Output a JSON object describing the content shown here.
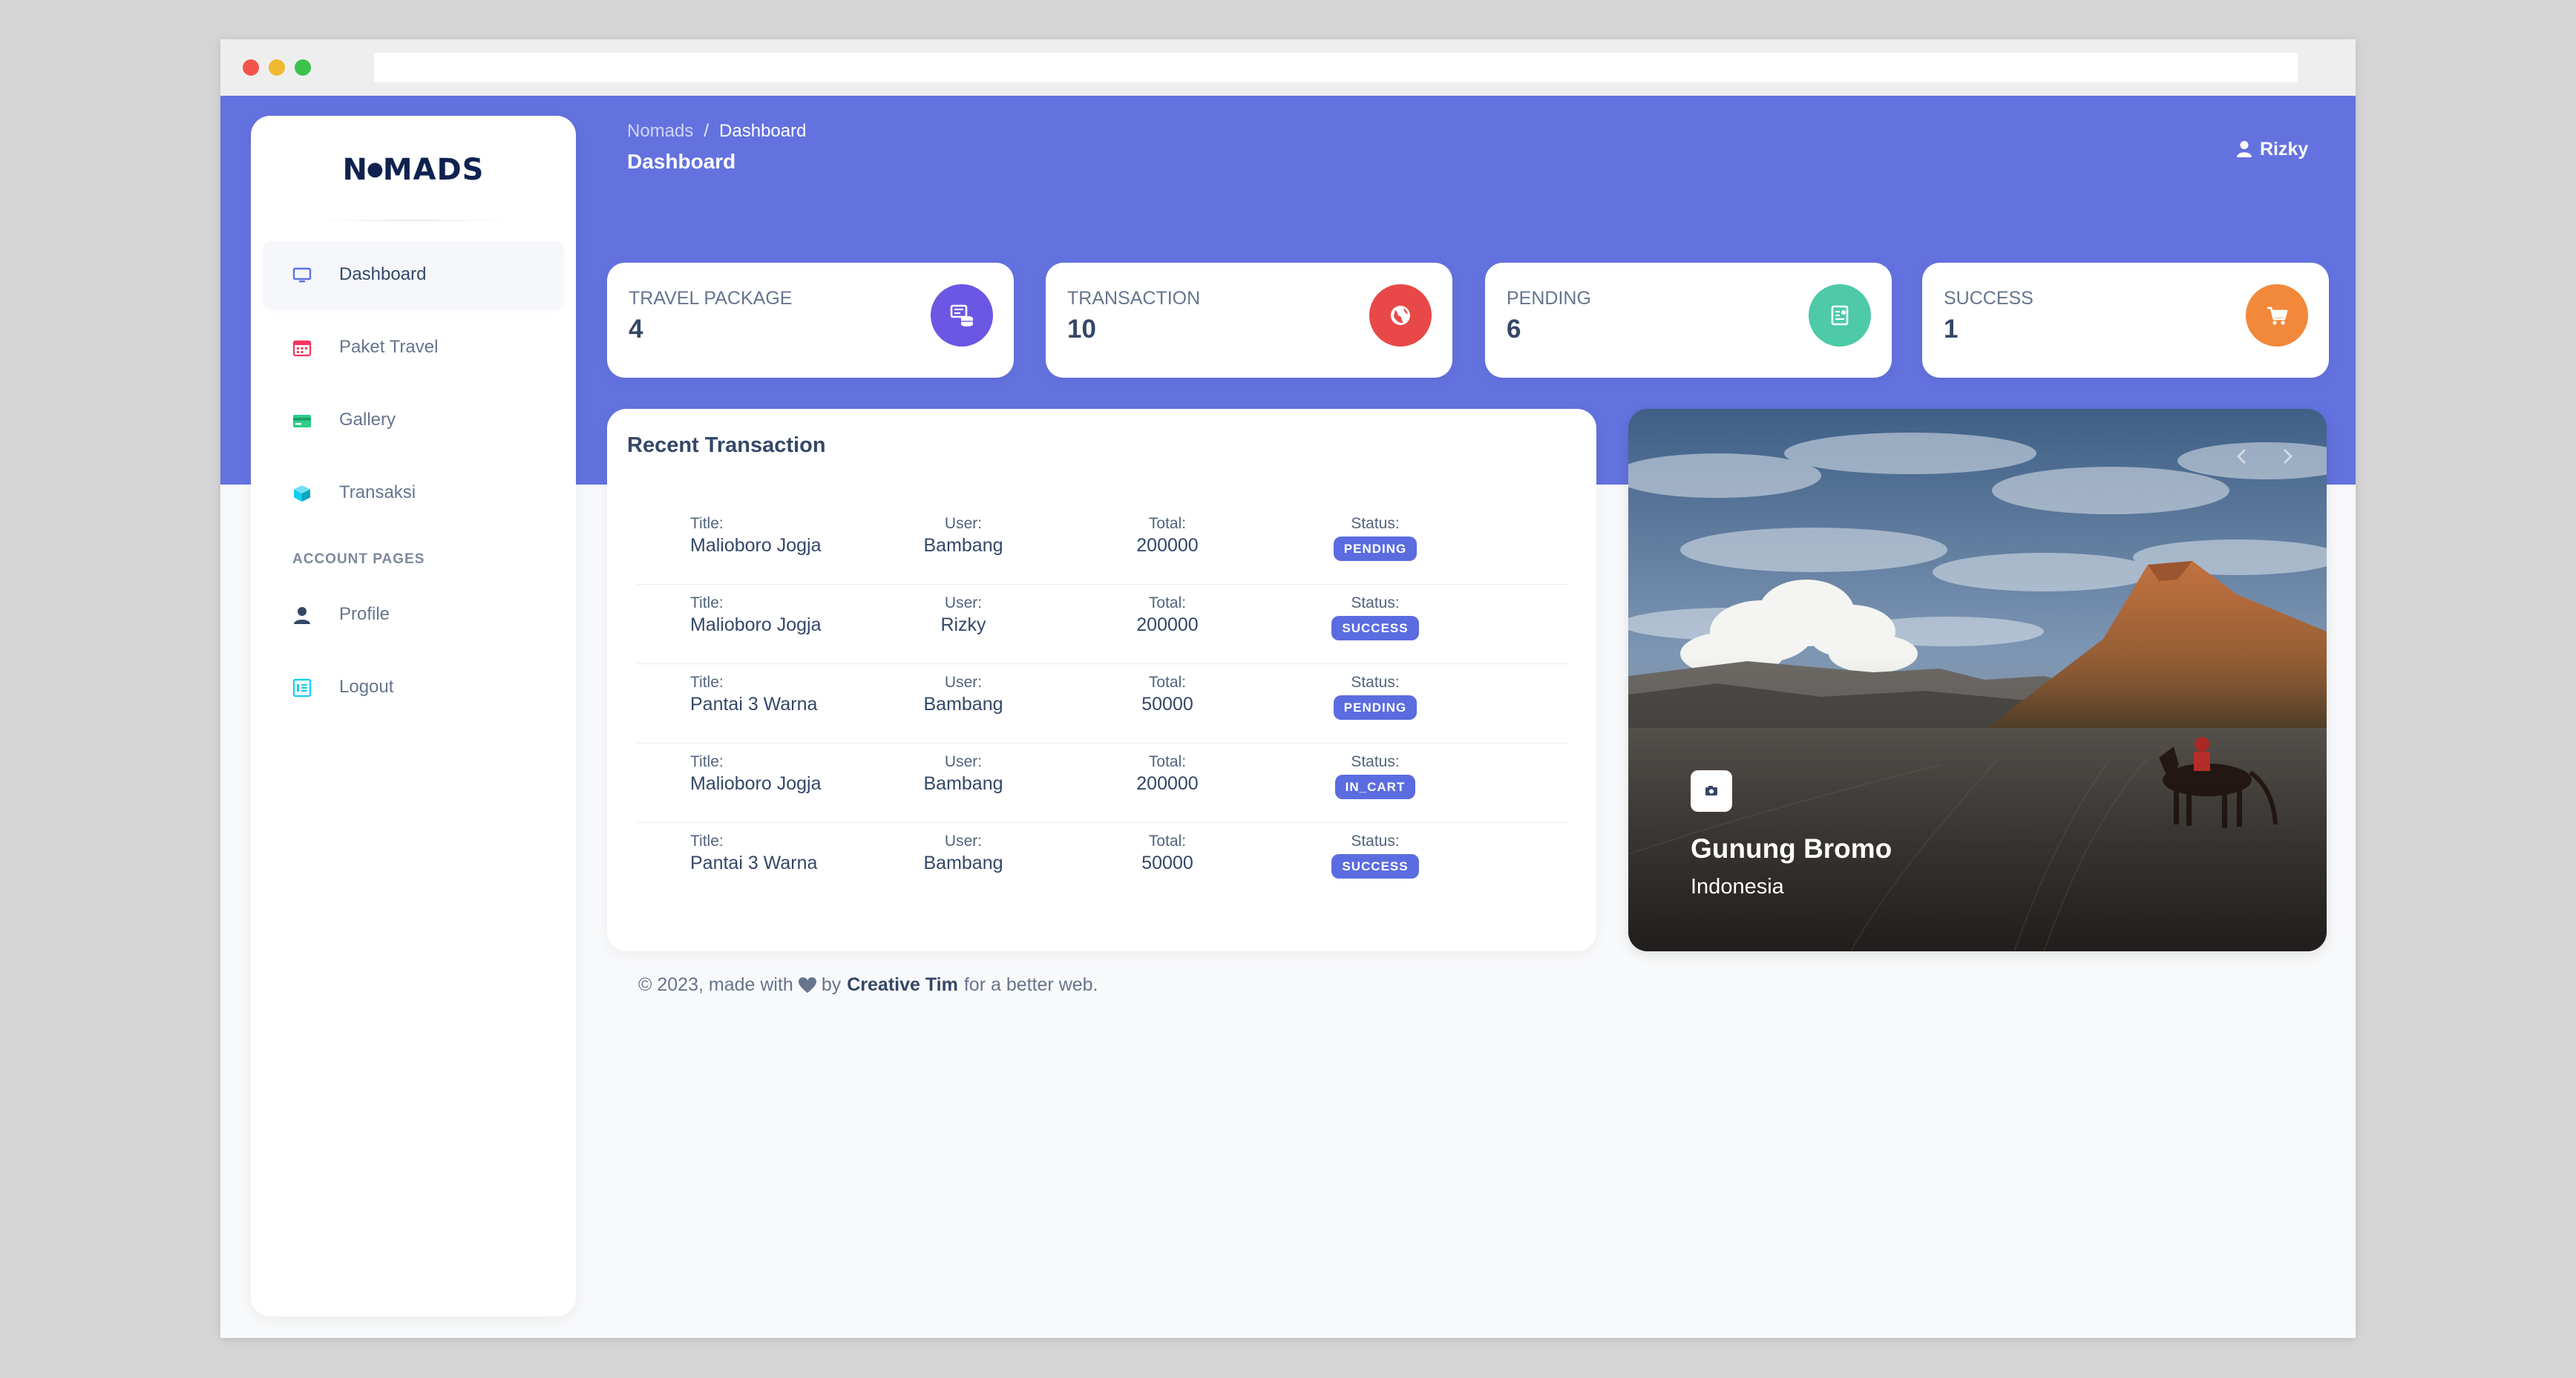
{
  "brand": {
    "logo_text": "N◦MADS"
  },
  "sidebar": {
    "items": [
      {
        "label": "Dashboard",
        "icon": "monitor-icon",
        "color": "#5e72e4"
      },
      {
        "label": "Paket Travel",
        "icon": "calendar-icon",
        "color": "#f5365c"
      },
      {
        "label": "Gallery",
        "icon": "credit-card-icon",
        "color": "#2dce89"
      },
      {
        "label": "Transaksi",
        "icon": "box-icon",
        "color": "#11cdef"
      }
    ],
    "section_title": "ACCOUNT PAGES",
    "account_items": [
      {
        "label": "Profile",
        "icon": "user-icon"
      },
      {
        "label": "Logout",
        "icon": "logout-icon"
      }
    ]
  },
  "header": {
    "breadcrumb_root": "Nomads",
    "breadcrumb_separator": "/",
    "breadcrumb_current": "Dashboard",
    "title": "Dashboard",
    "user_name": "Rizky"
  },
  "stats": [
    {
      "label": "TRAVEL PACKAGE",
      "value": "4",
      "icon": "database-icon",
      "color": "#6b57e3"
    },
    {
      "label": "TRANSACTION",
      "value": "10",
      "icon": "globe-icon",
      "color": "#e94848"
    },
    {
      "label": "PENDING",
      "value": "6",
      "icon": "document-icon",
      "color": "#4ecaa8"
    },
    {
      "label": "SUCCESS",
      "value": "1",
      "icon": "cart-icon",
      "color": "#f2883a"
    }
  ],
  "recent": {
    "title": "Recent Transaction",
    "labels": {
      "title": "Title:",
      "user": "User:",
      "total": "Total:",
      "status": "Status:"
    },
    "rows": [
      {
        "title": "Malioboro Jogja",
        "user": "Bambang",
        "total": "200000",
        "status": "PENDING"
      },
      {
        "title": "Malioboro Jogja",
        "user": "Rizky",
        "total": "200000",
        "status": "SUCCESS"
      },
      {
        "title": "Pantai 3 Warna",
        "user": "Bambang",
        "total": "50000",
        "status": "PENDING"
      },
      {
        "title": "Malioboro Jogja",
        "user": "Bambang",
        "total": "200000",
        "status": "IN_CART"
      },
      {
        "title": "Pantai 3 Warna",
        "user": "Bambang",
        "total": "50000",
        "status": "SUCCESS"
      }
    ]
  },
  "feature": {
    "title": "Gunung Bromo",
    "subtitle": "Indonesia",
    "icon": "camera-icon"
  },
  "footer": {
    "prefix": "© 2023, made with",
    "by": "by",
    "author": "Creative Tim",
    "suffix": "for a better web."
  },
  "colors": {
    "primary": "#6372df",
    "badge": "#5b6ce0",
    "text_dark": "#344767",
    "text_muted": "#67748e"
  }
}
